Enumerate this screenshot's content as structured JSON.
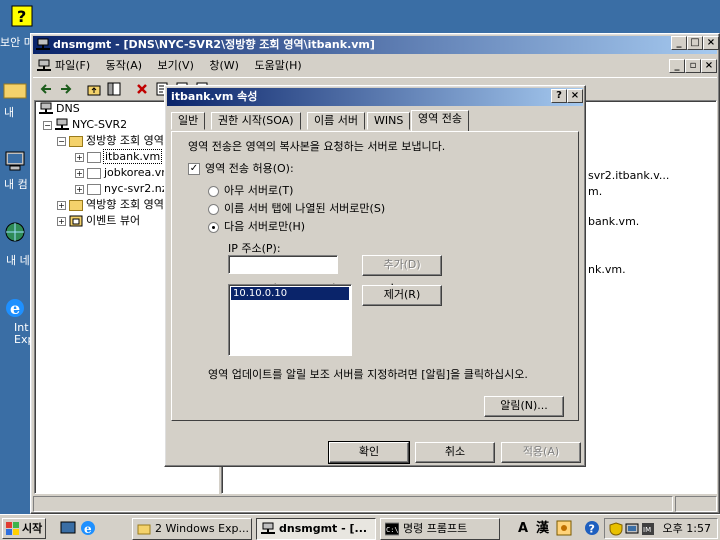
{
  "desktop": {
    "icons": [
      {
        "label": "보안 마"
      },
      {
        "label": "내"
      },
      {
        "label": "내 컴"
      },
      {
        "label": "내 네"
      },
      {
        "label": "Int Exp"
      }
    ]
  },
  "mmc": {
    "title": "dnsmgmt - [DNS\\NYC-SVR2\\정방향 조회 영역\\itbank.vm]",
    "menu": [
      "파일(F)",
      "동작(A)",
      "보기(V)",
      "창(W)",
      "도움말(H)"
    ],
    "tree": {
      "root": "DNS",
      "server": "NYC-SVR2",
      "forward_zones": "정방향 조회 영역",
      "zones": [
        "itbank.vm",
        "jobkorea.vm",
        "nyc-svr2.nz"
      ],
      "reverse_zones": "역방향 조회 영역",
      "event_viewer": "이벤트 뷰어"
    },
    "list_fragments": [
      "svr2.itbank.v...",
      "m.",
      "bank.vm.",
      "nk.vm."
    ]
  },
  "dialog": {
    "title": "itbank.vm 속성",
    "tabs": [
      "일반",
      "권한 시작(SOA)",
      "이름 서버",
      "WINS",
      "영역 전송"
    ],
    "active_tab": 4,
    "description": "영역 전송은 영역의 복사본을 요청하는 서버로 보냅니다.",
    "allow_transfer_label": "영역 전송 허용(O):",
    "allow_transfer_checked": true,
    "radio_options": [
      "아무 서버로(T)",
      "이름 서버 탭에 나열된 서버로만(S)",
      "다음 서버로만(H)"
    ],
    "selected_radio": 2,
    "ip_label": "IP 주소(P):",
    "ip_placeholder": " .  .  .",
    "add_button": "추가(D)",
    "remove_button": "제거(R)",
    "ip_list": [
      "10.10.0.10"
    ],
    "notify_text": "영역 업데이트를 알릴 보조 서버를 지정하려면 [알림]을 클릭하십시오.",
    "notify_button": "알림(N)...",
    "ok_button": "확인",
    "cancel_button": "취소",
    "apply_button": "적용(A)",
    "help_glyph": "?",
    "close_glyph": "×"
  },
  "taskbar": {
    "start_label": "시작",
    "items": [
      {
        "label": "2 Windows Exp..."
      },
      {
        "label": "dnsmgmt - [..."
      },
      {
        "label": "명령 프롬프트"
      }
    ],
    "ime": [
      "A",
      "漢"
    ],
    "clock": "오후 1:57"
  },
  "colors": {
    "desktop": "#3a6ea5",
    "face": "#d4d0c8",
    "title_active": "#0a246a",
    "selection": "#0a246a"
  }
}
